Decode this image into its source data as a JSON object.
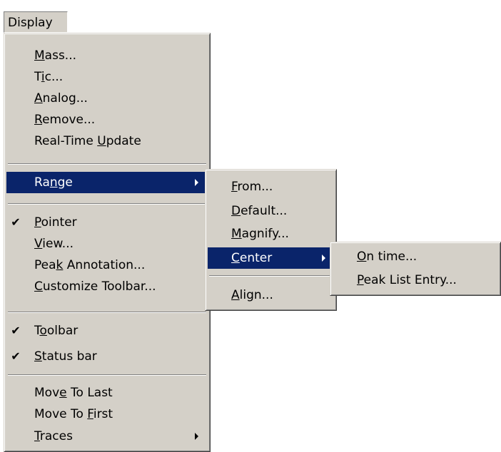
{
  "menubar": {
    "display_label": "Display"
  },
  "display_menu": {
    "items": [
      {
        "pre": "",
        "key": "M",
        "post": "ass..."
      },
      {
        "pre": "T",
        "key": "i",
        "post": "c..."
      },
      {
        "pre": "",
        "key": "A",
        "post": "nalog..."
      },
      {
        "pre": "",
        "key": "R",
        "post": "emove..."
      },
      {
        "pre": "Real-Time ",
        "key": "U",
        "post": "pdate"
      },
      {
        "pre": "Ra",
        "key": "n",
        "post": "ge"
      },
      {
        "pre": "",
        "key": "P",
        "post": "ointer"
      },
      {
        "pre": "",
        "key": "V",
        "post": "iew..."
      },
      {
        "pre": "Pea",
        "key": "k",
        "post": " Annotation..."
      },
      {
        "pre": "",
        "key": "C",
        "post": "ustomize Toolbar..."
      },
      {
        "pre": "T",
        "key": "o",
        "post": "olbar"
      },
      {
        "pre": "",
        "key": "S",
        "post": "tatus bar"
      },
      {
        "pre": "Mov",
        "key": "e",
        "post": " To Last"
      },
      {
        "pre": "Move To ",
        "key": "F",
        "post": "irst"
      },
      {
        "pre": "",
        "key": "T",
        "post": "races"
      }
    ],
    "check_glyph": "✔"
  },
  "range_menu": {
    "items": [
      {
        "pre": "",
        "key": "F",
        "post": "rom..."
      },
      {
        "pre": "",
        "key": "D",
        "post": "efault..."
      },
      {
        "pre": "",
        "key": "M",
        "post": "agnify..."
      },
      {
        "pre": "",
        "key": "C",
        "post": "enter"
      },
      {
        "pre": "",
        "key": "A",
        "post": "lign..."
      }
    ]
  },
  "center_menu": {
    "items": [
      {
        "pre": "",
        "key": "O",
        "post": "n time..."
      },
      {
        "pre": "",
        "key": "P",
        "post": "eak List Entry..."
      }
    ]
  },
  "colors": {
    "menu_bg": "#d4d0c8",
    "highlight": "#0a246a",
    "highlight_text": "#ffffff"
  }
}
